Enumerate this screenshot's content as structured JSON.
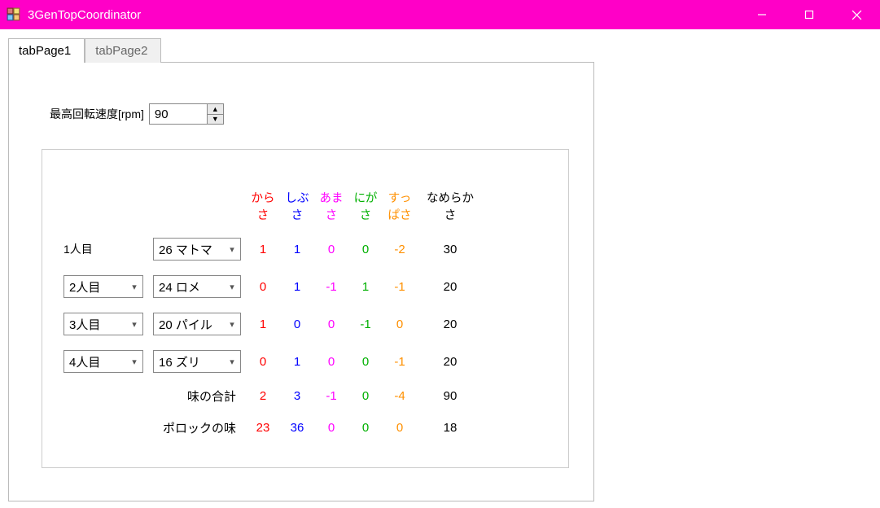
{
  "window": {
    "title": "3GenTopCoordinator"
  },
  "tabs": [
    "tabPage1",
    "tabPage2"
  ],
  "rpm": {
    "label": "最高回転速度[rpm]",
    "value": "90"
  },
  "headers": {
    "spicy": "からさ",
    "dry": "しぶさ",
    "sweet": "あまさ",
    "bitter": "にがさ",
    "sour": "すっぱさ",
    "smooth": "なめらかさ"
  },
  "rows": [
    {
      "player_label": "1人目",
      "player_is_combo": false,
      "berry": "26 マトマ",
      "vals": [
        "1",
        "1",
        "0",
        "0",
        "-2"
      ],
      "smooth": "30"
    },
    {
      "player_label": "2人目",
      "player_is_combo": true,
      "berry": "24 ロメ",
      "vals": [
        "0",
        "1",
        "-1",
        "1",
        "-1"
      ],
      "smooth": "20"
    },
    {
      "player_label": "3人目",
      "player_is_combo": true,
      "berry": "20 パイル",
      "vals": [
        "1",
        "0",
        "0",
        "-1",
        "0"
      ],
      "smooth": "20"
    },
    {
      "player_label": "4人目",
      "player_is_combo": true,
      "berry": "16 ズリ",
      "vals": [
        "0",
        "1",
        "0",
        "0",
        "-1"
      ],
      "smooth": "20"
    }
  ],
  "totals_label": "味の合計",
  "totals": {
    "vals": [
      "2",
      "3",
      "-1",
      "0",
      "-4"
    ],
    "smooth": "90"
  },
  "polock_label": "ポロックの味",
  "polock": {
    "vals": [
      "23",
      "36",
      "0",
      "0",
      "0"
    ],
    "smooth": "18"
  }
}
